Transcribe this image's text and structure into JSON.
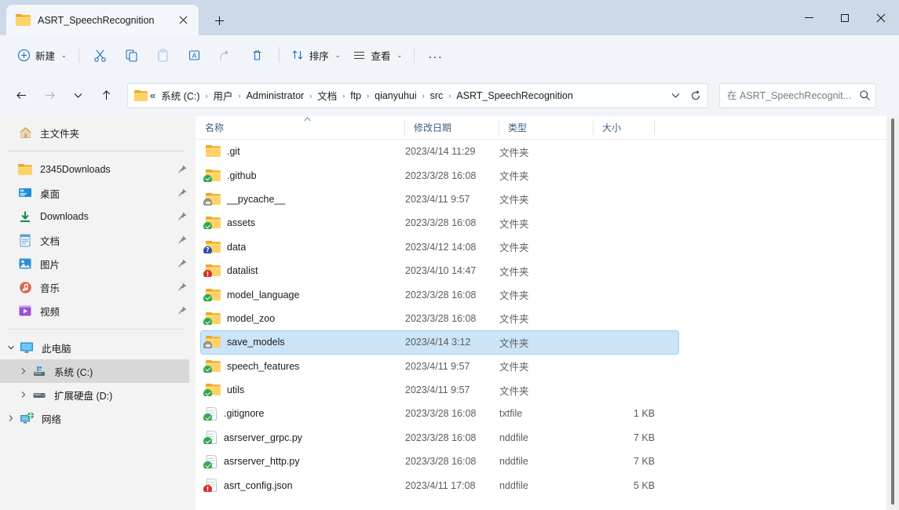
{
  "window": {
    "tab": {
      "title": "ASRT_SpeechRecognition",
      "folder_icon": "folder-icon",
      "close_icon": "close-icon"
    },
    "new_tab_label": "+",
    "controls": {
      "minimize": "minimize-icon",
      "maximize": "maximize-icon",
      "close": "close-icon"
    },
    "titlebar_color": "#ccd9e8"
  },
  "toolbar": {
    "new_label": "新建",
    "sort_label": "排序",
    "view_label": "查看",
    "more_label": "...",
    "icons": {
      "new": "plus-circle-icon",
      "cut": "scissors-icon",
      "copy": "copy-icon",
      "paste": "paste-icon",
      "rename": "rename-icon",
      "share": "share-icon",
      "delete": "trash-icon",
      "sort": "sort-arrows-icon",
      "view": "list-lines-icon",
      "more": "ellipsis-icon"
    },
    "accent_color": "#1a6fc4"
  },
  "nav": {
    "back_icon": "arrow-left-icon",
    "forward_icon": "arrow-right-icon",
    "recent_icon": "chevron-down-icon",
    "up_icon": "arrow-up-icon",
    "overflow_marker": "«",
    "separator": "›",
    "crumbs": [
      "系统 (C:)",
      "用户",
      "Administrator",
      "文档",
      "ftp",
      "qianyuhui",
      "src",
      "ASRT_SpeechRecognition"
    ],
    "dropdown_icon": "chevron-down-icon",
    "refresh_icon": "refresh-icon"
  },
  "search": {
    "placeholder": "在 ASRT_SpeechRecognit...",
    "value": "",
    "icon": "search-icon"
  },
  "sidebar": {
    "home": {
      "label": "主文件夹",
      "icon": "home-icon"
    },
    "quick_access": [
      {
        "label": "2345Downloads",
        "icon": "folder-icon",
        "pinned": true
      },
      {
        "label": "桌面",
        "icon": "desktop-icon",
        "pinned": true
      },
      {
        "label": "Downloads",
        "icon": "download-icon",
        "pinned": true
      },
      {
        "label": "文档",
        "icon": "documents-icon",
        "pinned": true
      },
      {
        "label": "图片",
        "icon": "pictures-icon",
        "pinned": true
      },
      {
        "label": "音乐",
        "icon": "music-icon",
        "pinned": true
      },
      {
        "label": "视频",
        "icon": "videos-icon",
        "pinned": true
      }
    ],
    "this_pc": {
      "label": "此电脑",
      "icon": "monitor-icon",
      "expanded": true
    },
    "drives": [
      {
        "label": "系统 (C:)",
        "icon": "system-drive-icon",
        "selected": true
      },
      {
        "label": "扩展硬盘 (D:)",
        "icon": "drive-icon",
        "selected": false
      }
    ],
    "network": {
      "label": "网络",
      "icon": "network-icon"
    },
    "selected_bg": "#d8d8d8"
  },
  "filelist": {
    "columns": [
      {
        "key": "name",
        "label": "名称",
        "sorted": "asc"
      },
      {
        "key": "date",
        "label": "修改日期"
      },
      {
        "key": "type",
        "label": "类型"
      },
      {
        "key": "size",
        "label": "大小"
      }
    ],
    "selection_bg": "#cce4f7",
    "selection_border": "#9ccef4",
    "rows": [
      {
        "name": ".git",
        "date": "2023/4/14 11:29",
        "type": "文件夹",
        "size": "",
        "kind": "folder",
        "badge": "none",
        "selected": false
      },
      {
        "name": ".github",
        "date": "2023/3/28 16:08",
        "type": "文件夹",
        "size": "",
        "kind": "folder",
        "badge": "check",
        "selected": false
      },
      {
        "name": "__pycache__",
        "date": "2023/4/11 9:57",
        "type": "文件夹",
        "size": "",
        "kind": "folder",
        "badge": "sync",
        "selected": false
      },
      {
        "name": "assets",
        "date": "2023/3/28 16:08",
        "type": "文件夹",
        "size": "",
        "kind": "folder",
        "badge": "check",
        "selected": false
      },
      {
        "name": "data",
        "date": "2023/4/12 14:08",
        "type": "文件夹",
        "size": "",
        "kind": "folder",
        "badge": "question",
        "selected": false
      },
      {
        "name": "datalist",
        "date": "2023/4/10 14:47",
        "type": "文件夹",
        "size": "",
        "kind": "folder",
        "badge": "alert",
        "selected": false
      },
      {
        "name": "model_language",
        "date": "2023/3/28 16:08",
        "type": "文件夹",
        "size": "",
        "kind": "folder",
        "badge": "check",
        "selected": false
      },
      {
        "name": "model_zoo",
        "date": "2023/3/28 16:08",
        "type": "文件夹",
        "size": "",
        "kind": "folder",
        "badge": "check",
        "selected": false
      },
      {
        "name": "save_models",
        "date": "2023/4/14 3:12",
        "type": "文件夹",
        "size": "",
        "kind": "folder",
        "badge": "sync",
        "selected": true
      },
      {
        "name": "speech_features",
        "date": "2023/4/11 9:57",
        "type": "文件夹",
        "size": "",
        "kind": "folder",
        "badge": "check",
        "selected": false
      },
      {
        "name": "utils",
        "date": "2023/4/11 9:57",
        "type": "文件夹",
        "size": "",
        "kind": "folder",
        "badge": "check",
        "selected": false
      },
      {
        "name": ".gitignore",
        "date": "2023/3/28 16:08",
        "type": "txtfile",
        "size": "1 KB",
        "kind": "file",
        "badge": "check",
        "selected": false
      },
      {
        "name": "asrserver_grpc.py",
        "date": "2023/3/28 16:08",
        "type": "nddfile",
        "size": "7 KB",
        "kind": "file",
        "badge": "check",
        "selected": false
      },
      {
        "name": "asrserver_http.py",
        "date": "2023/3/28 16:08",
        "type": "nddfile",
        "size": "7 KB",
        "kind": "file",
        "badge": "check",
        "selected": false
      },
      {
        "name": "asrt_config.json",
        "date": "2023/4/11 17:08",
        "type": "nddfile",
        "size": "5 KB",
        "kind": "file",
        "badge": "alert",
        "selected": false
      }
    ]
  },
  "scrollbar": {
    "orientation": "vertical",
    "thumb_color": "#787878"
  }
}
